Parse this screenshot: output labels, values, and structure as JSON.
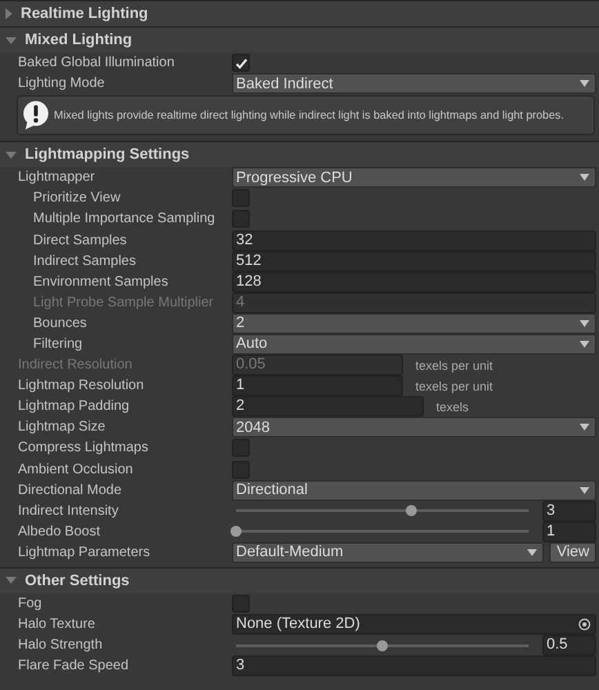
{
  "sections": [
    {
      "title": "Realtime Lighting",
      "expanded": false
    },
    {
      "title": "Mixed Lighting",
      "expanded": true,
      "rows": [
        {
          "kind": "checkbox",
          "label": "Baked Global Illumination",
          "disabled": false,
          "checked": true
        },
        {
          "kind": "dropdown",
          "label": "Lighting Mode",
          "disabled": false,
          "value": "Baked Indirect"
        },
        {
          "kind": "help",
          "text": "Mixed lights provide realtime direct lighting while indirect light is baked into lightmaps and light probes."
        }
      ]
    },
    {
      "title": "Lightmapping Settings",
      "expanded": true,
      "rows": [
        {
          "kind": "dropdown",
          "label": "Lightmapper",
          "disabled": false,
          "value": "Progressive CPU",
          "children": [
            {
              "kind": "checkbox",
              "label": "Prioritize View",
              "disabled": false,
              "checked": false
            },
            {
              "kind": "checkbox",
              "label": "Multiple Importance Sampling",
              "disabled": false,
              "checked": false
            },
            {
              "kind": "field",
              "label": "Direct Samples",
              "disabled": false,
              "value": "32"
            },
            {
              "kind": "field",
              "label": "Indirect Samples",
              "disabled": false,
              "value": "512"
            },
            {
              "kind": "field",
              "label": "Environment Samples",
              "disabled": false,
              "value": "128"
            },
            {
              "kind": "field",
              "label": "Light Probe Sample Multiplier",
              "disabled": true,
              "value": "4"
            },
            {
              "kind": "dropdown",
              "label": "Bounces",
              "disabled": false,
              "value": "2"
            },
            {
              "kind": "dropdown",
              "label": "Filtering",
              "disabled": false,
              "value": "Auto"
            }
          ]
        },
        {
          "kind": "field",
          "label": "Indirect Resolution",
          "disabled": true,
          "value": "0.05",
          "unit": "texels per unit"
        },
        {
          "kind": "field",
          "label": "Lightmap Resolution",
          "disabled": false,
          "value": "1",
          "unit": "texels per unit"
        },
        {
          "kind": "field",
          "label": "Lightmap Padding",
          "disabled": false,
          "value": "2",
          "unit": "texels"
        },
        {
          "kind": "dropdown",
          "label": "Lightmap Size",
          "disabled": false,
          "value": "2048"
        },
        {
          "kind": "checkbox",
          "label": "Compress Lightmaps",
          "disabled": false,
          "checked": false
        },
        {
          "kind": "checkbox",
          "label": "Ambient Occlusion",
          "disabled": false,
          "checked": false
        },
        {
          "kind": "dropdown",
          "label": "Directional Mode",
          "disabled": false,
          "value": "Directional"
        },
        {
          "kind": "slider",
          "label": "Indirect Intensity",
          "disabled": false,
          "level": 0.6,
          "value": "3"
        },
        {
          "kind": "slider",
          "label": "Albedo Boost",
          "disabled": false,
          "level": 0,
          "value": "1"
        },
        {
          "kind": "dropdown",
          "label": "Lightmap Parameters",
          "disabled": false,
          "value": "Default-Medium",
          "button": "View"
        }
      ]
    },
    {
      "title": "Other Settings",
      "expanded": true,
      "rows": [
        {
          "kind": "checkbox",
          "label": "Fog",
          "disabled": false,
          "checked": false
        },
        {
          "kind": "object",
          "label": "Halo Texture",
          "disabled": false,
          "value": "None (Texture 2D)"
        },
        {
          "kind": "slider",
          "label": "Halo Strength",
          "disabled": false,
          "level": 0.5,
          "value": "0.5"
        },
        {
          "kind": "field",
          "label": "Flare Fade Speed",
          "disabled": false,
          "value": "3"
        }
      ]
    }
  ]
}
